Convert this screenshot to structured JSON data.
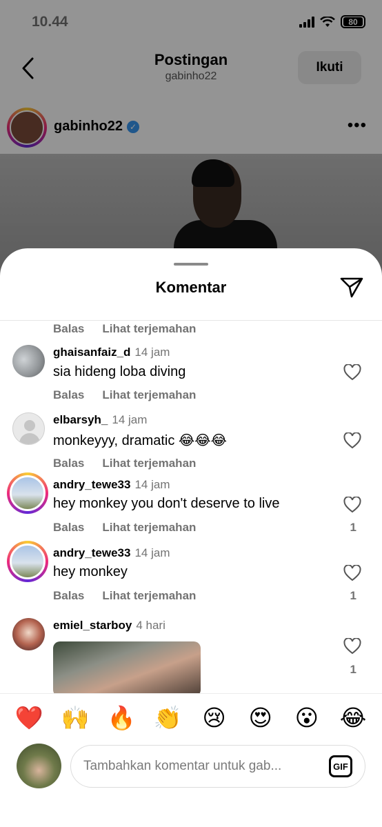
{
  "status_bar": {
    "time": "10.44",
    "battery": "80"
  },
  "header": {
    "title": "Postingan",
    "subtitle": "gabinho22",
    "follow_label": "Ikuti"
  },
  "post": {
    "username": "gabinho22",
    "more": "•••"
  },
  "sheet": {
    "title": "Komentar"
  },
  "actions": {
    "reply": "Balas",
    "translate": "Lihat terjemahan"
  },
  "comments": [
    {
      "username": "ghaisanfaiz_d",
      "time": "14 jam",
      "text": "sia hideng loba diving",
      "likes": ""
    },
    {
      "username": "elbarsyh_",
      "time": "14 jam",
      "text": "monkeyyy, dramatic 😂😂😂",
      "likes": ""
    },
    {
      "username": "andry_tewe33",
      "time": "14 jam",
      "text": "hey monkey you don't deserve to live",
      "likes": "1"
    },
    {
      "username": "andry_tewe33",
      "time": "14 jam",
      "text": "hey monkey",
      "likes": "1"
    },
    {
      "username": "emiel_starboy",
      "time": "4 hari",
      "text": "",
      "likes": "1"
    }
  ],
  "emoji_bar": [
    "❤️",
    "🙌",
    "🔥",
    "👏",
    "😢",
    "😍",
    "😮",
    "😂"
  ],
  "composer": {
    "placeholder": "Tambahkan komentar untuk gab...",
    "gif_label": "GIF"
  }
}
